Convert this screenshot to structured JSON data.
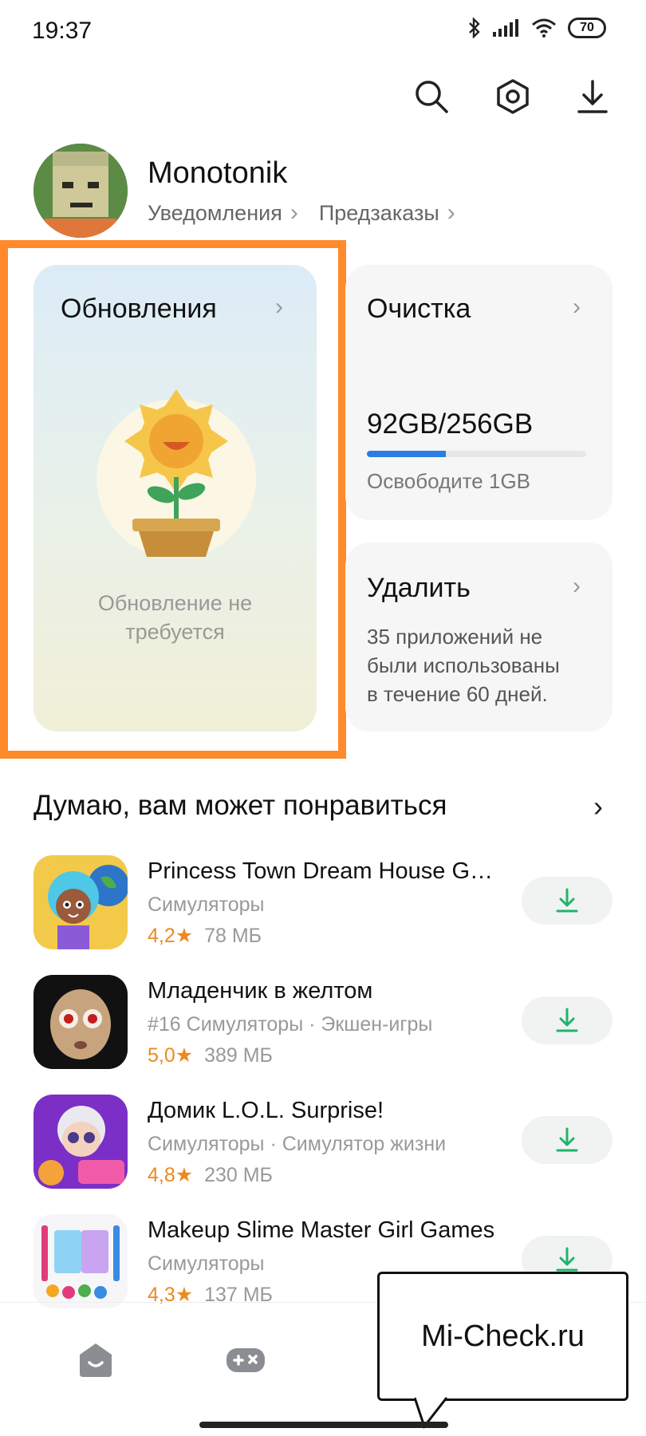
{
  "status_bar": {
    "time": "19:37",
    "battery": "70",
    "icons": [
      "bluetooth-icon",
      "signal-icon",
      "wifi-icon",
      "battery-icon"
    ]
  },
  "toolbar": {
    "icons": [
      "search-icon",
      "settings-hexagon-icon",
      "download-icon"
    ]
  },
  "profile": {
    "name": "Monotonik",
    "links": [
      "Уведомления",
      "Предзаказы"
    ]
  },
  "updates_card": {
    "title": "Обновления",
    "status_line1": "Обновление не",
    "status_line2": "требуется"
  },
  "clean_card": {
    "title": "Очистка",
    "storage": "92GB/256GB",
    "storage_used_fraction": 0.36,
    "free_hint": "Освободите 1GB"
  },
  "delete_card": {
    "title": "Удалить",
    "line1": "35 приложений не",
    "line2": "были использованы",
    "line3": "в течение 60 дней."
  },
  "recommend": {
    "title": "Думаю, вам может понравиться",
    "apps": [
      {
        "name": "Princess Town Dream House G…",
        "category": "Симуляторы",
        "rating": "4,2★",
        "size": "78 МБ"
      },
      {
        "name": "Младенчик в желтом",
        "category": "#16 Симуляторы · Экшен-игры",
        "rating": "5,0★",
        "size": "389 МБ"
      },
      {
        "name": "Домик L.O.L. Surprise!",
        "category": "Симуляторы · Симулятор жизни",
        "rating": "4,8★",
        "size": "230 МБ"
      },
      {
        "name": "Makeup Slime Master Girl Games",
        "category": "Симуляторы",
        "rating": "4,3★",
        "size": "137 МБ"
      }
    ]
  },
  "bottom_nav": {
    "icons": [
      "home-icon",
      "games-icon"
    ]
  },
  "watermark": {
    "text": "Mi-Check.ru"
  },
  "colors": {
    "accent_blue": "#2b7de0",
    "rating_orange": "#ec8a1f",
    "download_green": "#1fb46a",
    "highlight_frame": "#ff8a2b"
  }
}
